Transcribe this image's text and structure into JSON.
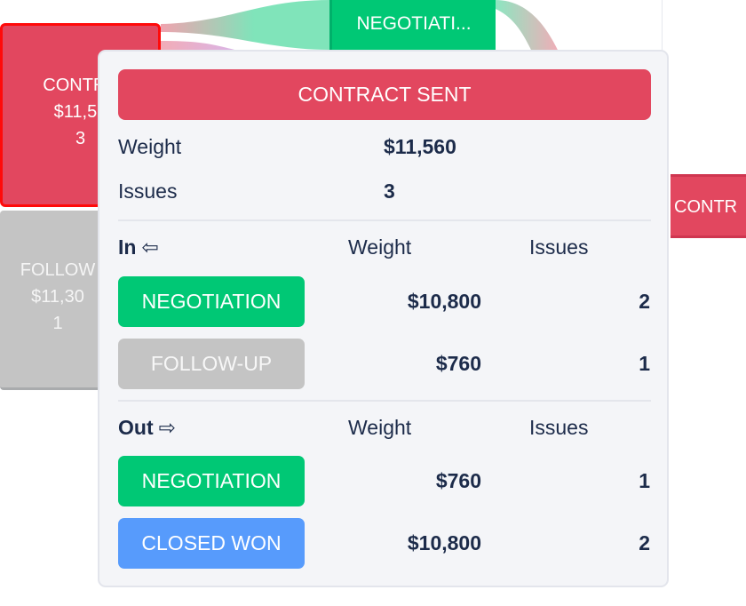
{
  "colors": {
    "contract_sent": "#e2475f",
    "negotiation": "#00c875",
    "follow_up": "#c4c4c4",
    "closed_won": "#579bfc",
    "text": "#1c2b4a"
  },
  "sankey": {
    "nodes": {
      "contract_sent": {
        "label": "CONTRA",
        "weight": "$11,56",
        "issues": "3"
      },
      "follow_up": {
        "label": "FOLLOW",
        "weight": "$11,30",
        "issues": "1"
      },
      "negotiation": {
        "label": "NEGOTIATI..."
      },
      "contract_right": {
        "label": "CONTR"
      }
    }
  },
  "tooltip": {
    "title": "CONTRACT SENT",
    "weight_label": "Weight",
    "weight_value": "$11,560",
    "issues_label": "Issues",
    "issues_value": "3",
    "in": {
      "title": "In",
      "icon": "arrow-left-icon",
      "col_weight": "Weight",
      "col_issues": "Issues",
      "rows": [
        {
          "stage": "NEGOTIATION",
          "weight": "$10,800",
          "issues": "2"
        },
        {
          "stage": "FOLLOW-UP",
          "weight": "$760",
          "issues": "1"
        }
      ]
    },
    "out": {
      "title": "Out",
      "icon": "arrow-right-icon",
      "col_weight": "Weight",
      "col_issues": "Issues",
      "rows": [
        {
          "stage": "NEGOTIATION",
          "weight": "$760",
          "issues": "1"
        },
        {
          "stage": "CLOSED WON",
          "weight": "$10,800",
          "issues": "2"
        }
      ]
    }
  }
}
